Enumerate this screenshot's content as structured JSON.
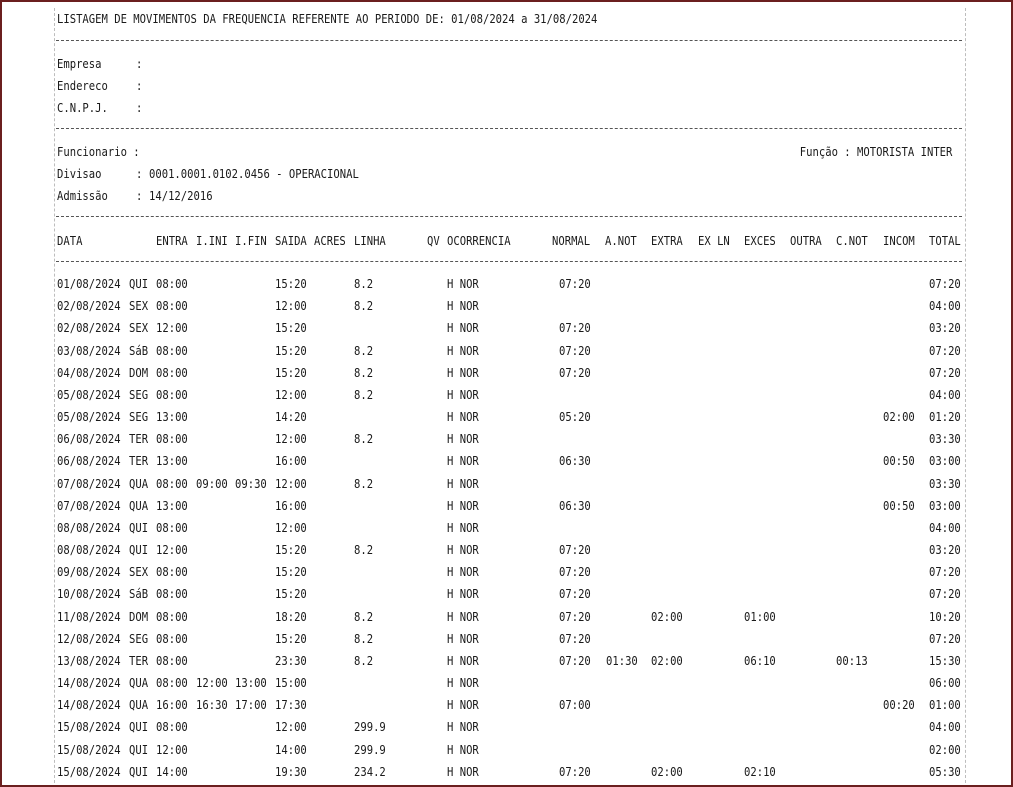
{
  "report": {
    "title": "LISTAGEM DE MOVIMENTOS DA FREQUENCIA REFERENTE AO PERIODO DE: 01/08/2024 a 31/08/2024",
    "company": {
      "empresa_label": "Empresa",
      "empresa_value": "",
      "endereco_label": "Endereco",
      "endereco_value": "",
      "cnpj_label": "C.N.P.J.",
      "cnpj_value": "",
      "sep": ":"
    },
    "employee": {
      "funcionario_label": "Funcionario :",
      "funcao_label": "Função : MOTORISTA INTER",
      "divisao_label": "Divisao",
      "divisao_value": "0001.0001.0102.0456 - OPERACIONAL",
      "admissao_label": "Admissão",
      "admissao_value": "14/12/2016",
      "sep": ":"
    },
    "columns": {
      "data": "DATA",
      "entra": "ENTRA",
      "iini": "I.INI",
      "ifin": "I.FIN",
      "saida": "SAIDA",
      "acres": "ACRES",
      "linha": "LINHA",
      "qv": "QV",
      "ocorrencia": "OCORRENCIA",
      "normal": "NORMAL",
      "anot": "A.NOT",
      "extra": "EXTRA",
      "exln": "EX LN",
      "exces": "EXCES",
      "outra": "OUTRA",
      "cnot": "C.NOT",
      "incom": "INCOM",
      "total": "TOTAL"
    },
    "rows": [
      {
        "data": "01/08/2024",
        "dia": "QUI",
        "entra": "08:00",
        "iini": "",
        "ifin": "",
        "saida": "15:20",
        "linha": "8.2",
        "oc": "H NOR",
        "normal": "07:20",
        "anot": "",
        "extra": "",
        "exces": "",
        "cnot": "",
        "incom": "",
        "total": "07:20"
      },
      {
        "data": "02/08/2024",
        "dia": "SEX",
        "entra": "08:00",
        "iini": "",
        "ifin": "",
        "saida": "12:00",
        "linha": "8.2",
        "oc": "H NOR",
        "normal": "",
        "anot": "",
        "extra": "",
        "exces": "",
        "cnot": "",
        "incom": "",
        "total": "04:00"
      },
      {
        "data": "02/08/2024",
        "dia": "SEX",
        "entra": "12:00",
        "iini": "",
        "ifin": "",
        "saida": "15:20",
        "linha": "",
        "oc": "H NOR",
        "normal": "07:20",
        "anot": "",
        "extra": "",
        "exces": "",
        "cnot": "",
        "incom": "",
        "total": "03:20"
      },
      {
        "data": "03/08/2024",
        "dia": "SáB",
        "entra": "08:00",
        "iini": "",
        "ifin": "",
        "saida": "15:20",
        "linha": "8.2",
        "oc": "H NOR",
        "normal": "07:20",
        "anot": "",
        "extra": "",
        "exces": "",
        "cnot": "",
        "incom": "",
        "total": "07:20"
      },
      {
        "data": "04/08/2024",
        "dia": "DOM",
        "entra": "08:00",
        "iini": "",
        "ifin": "",
        "saida": "15:20",
        "linha": "8.2",
        "oc": "H NOR",
        "normal": "07:20",
        "anot": "",
        "extra": "",
        "exces": "",
        "cnot": "",
        "incom": "",
        "total": "07:20"
      },
      {
        "data": "05/08/2024",
        "dia": "SEG",
        "entra": "08:00",
        "iini": "",
        "ifin": "",
        "saida": "12:00",
        "linha": "8.2",
        "oc": "H NOR",
        "normal": "",
        "anot": "",
        "extra": "",
        "exces": "",
        "cnot": "",
        "incom": "",
        "total": "04:00"
      },
      {
        "data": "05/08/2024",
        "dia": "SEG",
        "entra": "13:00",
        "iini": "",
        "ifin": "",
        "saida": "14:20",
        "linha": "",
        "oc": "H NOR",
        "normal": "05:20",
        "anot": "",
        "extra": "",
        "exces": "",
        "cnot": "",
        "incom": "02:00",
        "total": "01:20"
      },
      {
        "data": "06/08/2024",
        "dia": "TER",
        "entra": "08:00",
        "iini": "",
        "ifin": "",
        "saida": "12:00",
        "linha": "8.2",
        "oc": "H NOR",
        "normal": "",
        "anot": "",
        "extra": "",
        "exces": "",
        "cnot": "",
        "incom": "",
        "total": "03:30"
      },
      {
        "data": "06/08/2024",
        "dia": "TER",
        "entra": "13:00",
        "iini": "",
        "ifin": "",
        "saida": "16:00",
        "linha": "",
        "oc": "H NOR",
        "normal": "06:30",
        "anot": "",
        "extra": "",
        "exces": "",
        "cnot": "",
        "incom": "00:50",
        "total": "03:00"
      },
      {
        "data": "07/08/2024",
        "dia": "QUA",
        "entra": "08:00",
        "iini": "09:00",
        "ifin": "09:30",
        "saida": "12:00",
        "linha": "8.2",
        "oc": "H NOR",
        "normal": "",
        "anot": "",
        "extra": "",
        "exces": "",
        "cnot": "",
        "incom": "",
        "total": "03:30"
      },
      {
        "data": "07/08/2024",
        "dia": "QUA",
        "entra": "13:00",
        "iini": "",
        "ifin": "",
        "saida": "16:00",
        "linha": "",
        "oc": "H NOR",
        "normal": "06:30",
        "anot": "",
        "extra": "",
        "exces": "",
        "cnot": "",
        "incom": "00:50",
        "total": "03:00"
      },
      {
        "data": "08/08/2024",
        "dia": "QUI",
        "entra": "08:00",
        "iini": "",
        "ifin": "",
        "saida": "12:00",
        "linha": "",
        "oc": "H NOR",
        "normal": "",
        "anot": "",
        "extra": "",
        "exces": "",
        "cnot": "",
        "incom": "",
        "total": "04:00"
      },
      {
        "data": "08/08/2024",
        "dia": "QUI",
        "entra": "12:00",
        "iini": "",
        "ifin": "",
        "saida": "15:20",
        "linha": "8.2",
        "oc": "H NOR",
        "normal": "07:20",
        "anot": "",
        "extra": "",
        "exces": "",
        "cnot": "",
        "incom": "",
        "total": "03:20"
      },
      {
        "data": "09/08/2024",
        "dia": "SEX",
        "entra": "08:00",
        "iini": "",
        "ifin": "",
        "saida": "15:20",
        "linha": "",
        "oc": "H NOR",
        "normal": "07:20",
        "anot": "",
        "extra": "",
        "exces": "",
        "cnot": "",
        "incom": "",
        "total": "07:20"
      },
      {
        "data": "10/08/2024",
        "dia": "SáB",
        "entra": "08:00",
        "iini": "",
        "ifin": "",
        "saida": "15:20",
        "linha": "",
        "oc": "H NOR",
        "normal": "07:20",
        "anot": "",
        "extra": "",
        "exces": "",
        "cnot": "",
        "incom": "",
        "total": "07:20"
      },
      {
        "data": "11/08/2024",
        "dia": "DOM",
        "entra": "08:00",
        "iini": "",
        "ifin": "",
        "saida": "18:20",
        "linha": "8.2",
        "oc": "H NOR",
        "normal": "07:20",
        "anot": "",
        "extra": "02:00",
        "exces": "01:00",
        "cnot": "",
        "incom": "",
        "total": "10:20"
      },
      {
        "data": "12/08/2024",
        "dia": "SEG",
        "entra": "08:00",
        "iini": "",
        "ifin": "",
        "saida": "15:20",
        "linha": "8.2",
        "oc": "H NOR",
        "normal": "07:20",
        "anot": "",
        "extra": "",
        "exces": "",
        "cnot": "",
        "incom": "",
        "total": "07:20"
      },
      {
        "data": "13/08/2024",
        "dia": "TER",
        "entra": "08:00",
        "iini": "",
        "ifin": "",
        "saida": "23:30",
        "linha": "8.2",
        "oc": "H NOR",
        "normal": "07:20",
        "anot": "01:30",
        "extra": "02:00",
        "exces": "06:10",
        "cnot": "00:13",
        "incom": "",
        "total": "15:30"
      },
      {
        "data": "14/08/2024",
        "dia": "QUA",
        "entra": "08:00",
        "iini": "12:00",
        "ifin": "13:00",
        "saida": "15:00",
        "linha": "",
        "oc": "H NOR",
        "normal": "",
        "anot": "",
        "extra": "",
        "exces": "",
        "cnot": "",
        "incom": "",
        "total": "06:00"
      },
      {
        "data": "14/08/2024",
        "dia": "QUA",
        "entra": "16:00",
        "iini": "16:30",
        "ifin": "17:00",
        "saida": "17:30",
        "linha": "",
        "oc": "H NOR",
        "normal": "07:00",
        "anot": "",
        "extra": "",
        "exces": "",
        "cnot": "",
        "incom": "00:20",
        "total": "01:00"
      },
      {
        "data": "15/08/2024",
        "dia": "QUI",
        "entra": "08:00",
        "iini": "",
        "ifin": "",
        "saida": "12:00",
        "linha": "299.9",
        "oc": "H NOR",
        "normal": "",
        "anot": "",
        "extra": "",
        "exces": "",
        "cnot": "",
        "incom": "",
        "total": "04:00"
      },
      {
        "data": "15/08/2024",
        "dia": "QUI",
        "entra": "12:00",
        "iini": "",
        "ifin": "",
        "saida": "14:00",
        "linha": "299.9",
        "oc": "H NOR",
        "normal": "",
        "anot": "",
        "extra": "",
        "exces": "",
        "cnot": "",
        "incom": "",
        "total": "02:00"
      },
      {
        "data": "15/08/2024",
        "dia": "QUI",
        "entra": "14:00",
        "iini": "",
        "ifin": "",
        "saida": "19:30",
        "linha": "234.2",
        "oc": "H NOR",
        "normal": "07:20",
        "anot": "",
        "extra": "02:00",
        "exces": "02:10",
        "cnot": "",
        "incom": "",
        "total": "05:30"
      }
    ]
  }
}
